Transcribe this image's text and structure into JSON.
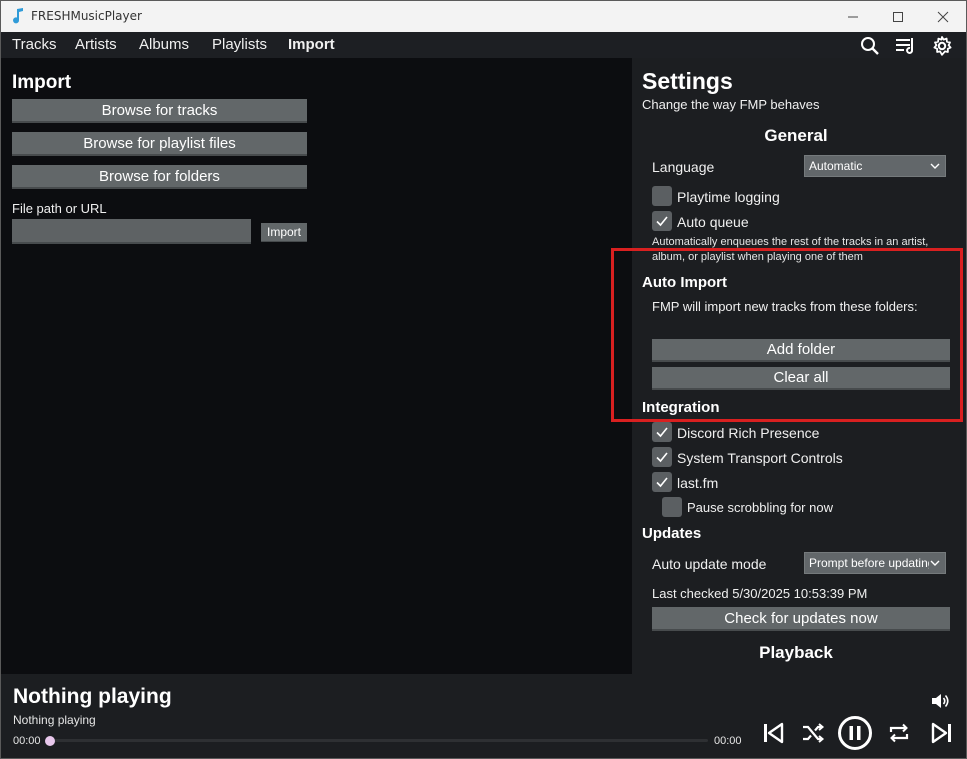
{
  "window": {
    "title": "FRESHMusicPlayer"
  },
  "nav": {
    "tabs": [
      "Tracks",
      "Artists",
      "Albums",
      "Playlists",
      "Import"
    ],
    "active": "Import"
  },
  "import_panel": {
    "title": "Import",
    "browse_tracks": "Browse for tracks",
    "browse_playlists": "Browse for playlist files",
    "browse_folders": "Browse for folders",
    "path_label": "File path or URL",
    "path_value": "",
    "import_button": "Import"
  },
  "settings": {
    "title": "Settings",
    "subtitle": "Change the way FMP behaves",
    "general": {
      "heading": "General",
      "language_label": "Language",
      "language_value": "Automatic",
      "playtime_logging": {
        "label": "Playtime logging",
        "checked": false
      },
      "auto_queue": {
        "label": "Auto queue",
        "checked": true
      },
      "auto_queue_desc": "Automatically enqueues the rest of the tracks in an artist, album, or playlist when playing one of them"
    },
    "auto_import": {
      "heading": "Auto Import",
      "desc": "FMP will import new tracks from these folders:",
      "add_folder": "Add folder",
      "clear_all": "Clear all"
    },
    "integration": {
      "heading": "Integration",
      "discord": {
        "label": "Discord Rich Presence",
        "checked": true
      },
      "transport": {
        "label": "System Transport Controls",
        "checked": true
      },
      "lastfm": {
        "label": "last.fm",
        "checked": true
      },
      "pause_scrobbling": {
        "label": "Pause scrobbling for now",
        "checked": false
      }
    },
    "updates": {
      "heading": "Updates",
      "mode_label": "Auto update mode",
      "mode_value": "Prompt before updating",
      "last_checked": "Last checked 5/30/2025 10:53:39 PM",
      "check_now": "Check for updates now"
    },
    "playback": {
      "heading": "Playback"
    }
  },
  "player": {
    "title": "Nothing playing",
    "subtitle": "Nothing playing",
    "elapsed": "00:00",
    "total": "00:00",
    "progress": 0
  },
  "colors": {
    "accent_knob": "#e8c8ec",
    "highlight": "#d92020"
  }
}
